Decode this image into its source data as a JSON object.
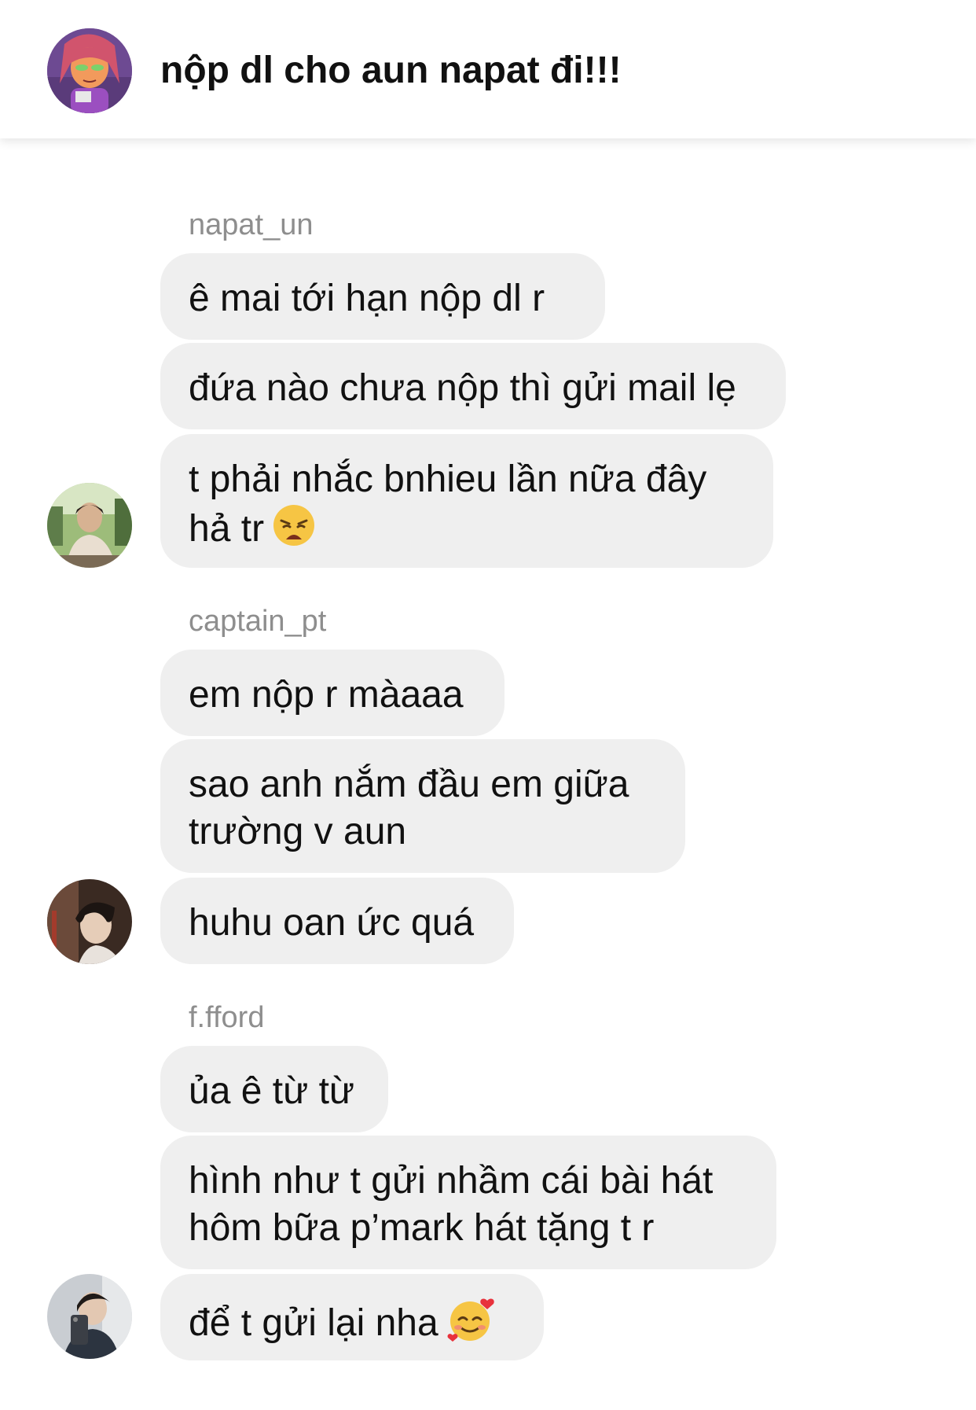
{
  "header": {
    "title": "nộp dl cho aun napat đi!!!"
  },
  "groups": [
    {
      "sender": "napat_un",
      "messages": [
        "ê mai tới hạn nộp dl r",
        "đứa nào chưa nộp thì gửi mail lẹ",
        "t phải nhắc bnhieu lần nữa đây hả tr"
      ]
    },
    {
      "sender": "captain_pt",
      "messages": [
        "em nộp r màaaa",
        "sao anh nắm đầu em giữa trường v aun",
        "huhu oan ức quá"
      ]
    },
    {
      "sender": "f.fford",
      "messages": [
        "ủa ê từ từ",
        "hình như t gửi nhầm cái bài hát hôm bữa p’mark hát tặng t r",
        "để t gửi lại nha"
      ]
    }
  ],
  "emojis": {
    "weary": "weary-face-emoji",
    "hearts": "smiling-face-with-hearts-emoji"
  },
  "colors": {
    "bubble": "#efefef",
    "sender": "#8e8e8e",
    "text": "#111111"
  }
}
